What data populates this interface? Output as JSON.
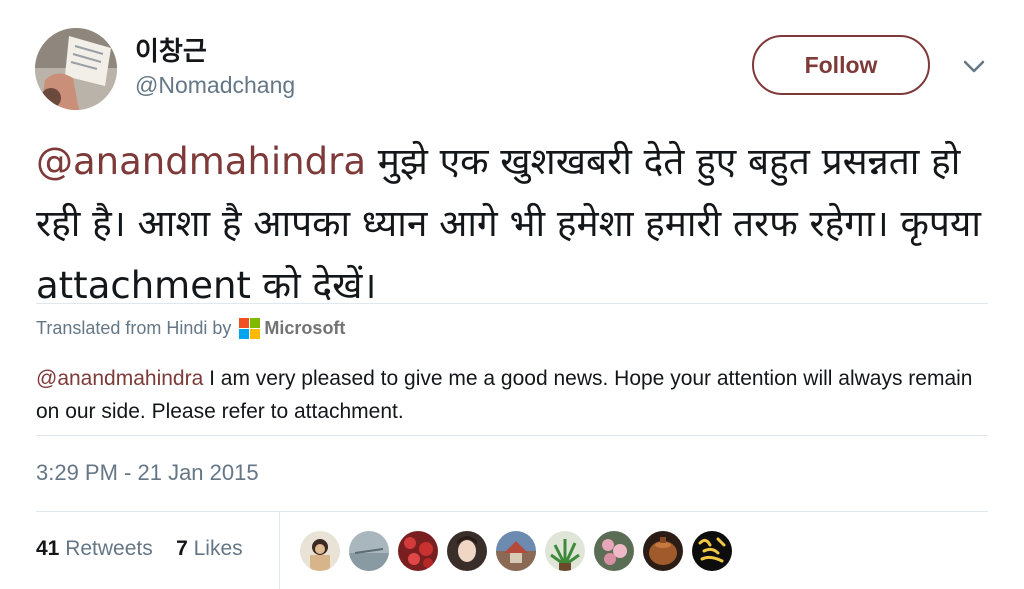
{
  "user": {
    "display_name": "이창근",
    "handle": "@Nomadchang",
    "follow_label": "Follow"
  },
  "tweet": {
    "mention": "@anandmahindra",
    "body": " मुझे एक खुशखबरी देते हुए बहुत प्रसन्नता हो रही है। आशा है आपका ध्यान आगे भी हमेशा हमारी तरफ रहेगा। कृपया attachment को देखें।"
  },
  "translation": {
    "label": "Translated from Hindi by",
    "provider": "Microsoft",
    "mention": "@anandmahindra",
    "text": " I am very pleased to give me a good news. Hope your attention will always remain on our side. Please refer to attachment."
  },
  "timestamp": "3:29 PM - 21 Jan 2015",
  "stats": {
    "retweets_count": "41",
    "retweets_label": "Retweets",
    "likes_count": "7",
    "likes_label": "Likes"
  },
  "colors": {
    "accent": "#7d3a39",
    "secondary_text": "#657786",
    "divider": "#e1e8ed"
  },
  "icons": {
    "more": "chevron-down-icon",
    "translator": "microsoft-logo"
  }
}
